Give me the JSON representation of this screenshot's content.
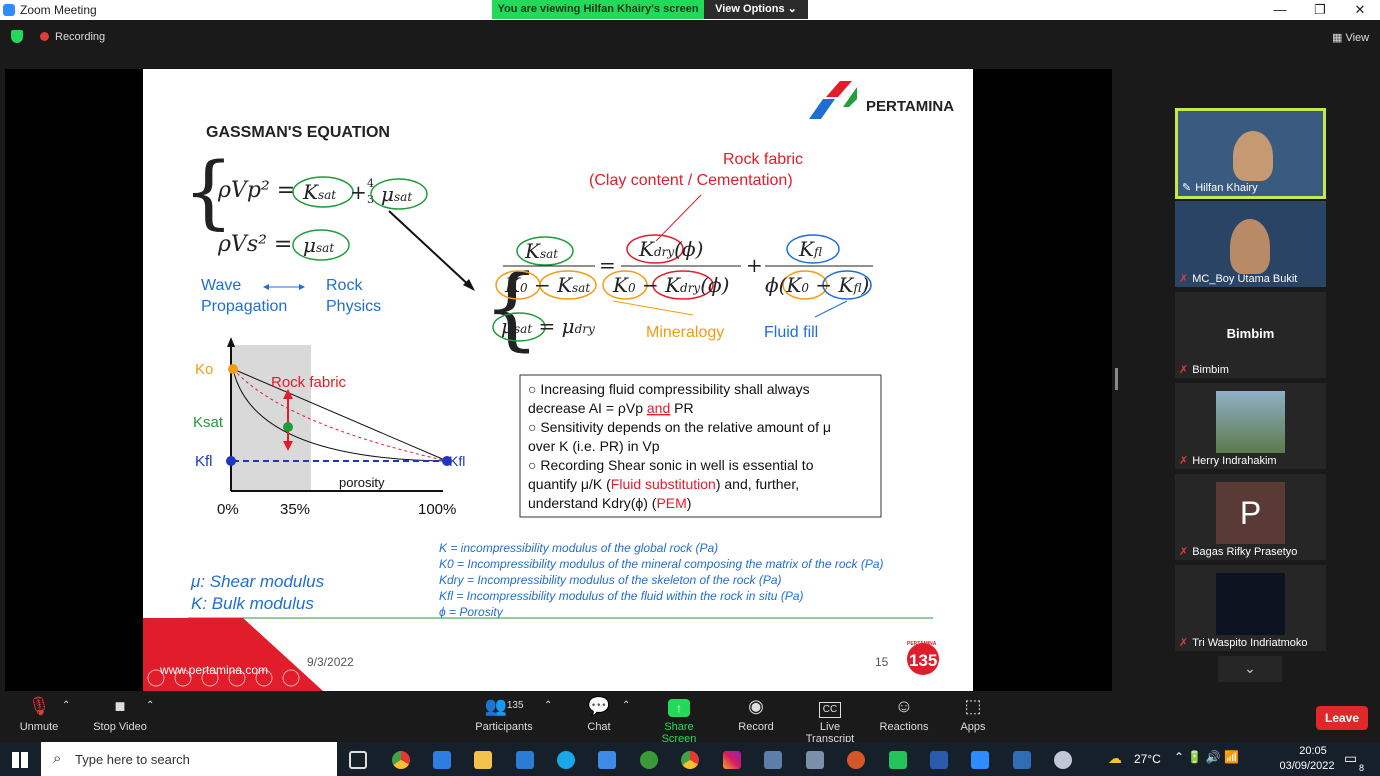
{
  "window": {
    "title": "Zoom Meeting"
  },
  "banner": {
    "viewing": "You are viewing Hilfan Khairy's screen",
    "view_options": "View Options"
  },
  "topbar": {
    "recording": "Recording",
    "view": "View"
  },
  "slide": {
    "logo": "PERTAMINA",
    "title": "GASSMAN'S EQUATION",
    "rock_fabric": "Rock fabric",
    "clay": "(Clay content / Cementation)",
    "mineralogy": "Mineralogy",
    "fluid_fill": "Fluid fill",
    "wave": "Wave",
    "propagation": "Propagation",
    "rock": "Rock",
    "physics": "Physics",
    "graph": {
      "k0": "Ko",
      "ksat": "Ksat",
      "kfl": "Kfl",
      "kfl_right": "Kfl",
      "rock_fabric": "Rock fabric",
      "porosity": "porosity",
      "t0": "0%",
      "t35": "35%",
      "t100": "100%"
    },
    "box": [
      "○ Increasing fluid compressibility shall always",
      "decrease AI = ρVp ",
      "and",
      " PR",
      "○ Sensitivity depends on the relative amount of μ",
      "over K (i.e. PR) in Vp",
      "○ Recording Shear sonic in well is essential to",
      "quantify μ/K (",
      "Fluid substitution",
      ") and, further,",
      "understand Kdry(ϕ) (",
      "PEM",
      ")"
    ],
    "defs": [
      "K = incompressibility modulus of the global rock (Pa)",
      "K0 = Incompressibility modulus of the mineral composing the matrix of the rock (Pa)",
      "Kdry = Incompressibility modulus of the skeleton of the rock (Pa)",
      "Kfl = Incompressibility modulus of the fluid within the rock in situ (Pa)",
      "ϕ = Porosity"
    ],
    "mu_shear": "μ: Shear modulus",
    "k_bulk": "K: Bulk modulus",
    "website": "www.pertamina.com",
    "date": "9/3/2022",
    "page": "15",
    "badge": "135",
    "badge_top": "PERTAMINA"
  },
  "participants": [
    {
      "name": "Hilfan Khairy",
      "type": "video",
      "active": true
    },
    {
      "name": "MC_Boy Utama Bukit",
      "type": "video"
    },
    {
      "name": "Bimbim",
      "type": "name",
      "label": "Bimbim"
    },
    {
      "name": "Herry Indrahakim",
      "type": "photo"
    },
    {
      "name": "Bagas Rifky Prasetyo",
      "type": "initial",
      "initial": "P"
    },
    {
      "name": "Tri Waspito Indriatmoko",
      "type": "photo"
    }
  ],
  "toolbar": {
    "unmute": "Unmute",
    "stop_video": "Stop Video",
    "participants": "Participants",
    "participants_count": "135",
    "chat": "Chat",
    "share": "Share Screen",
    "record": "Record",
    "transcript": "Live Transcript",
    "reactions": "Reactions",
    "apps": "Apps",
    "leave": "Leave"
  },
  "taskbar": {
    "search_placeholder": "Type here to search",
    "temp": "27°C",
    "time": "20:05",
    "date": "03/09/2022",
    "notif_count": "8"
  },
  "colors": {
    "zoom_green": "#23d959",
    "leave_red": "#e02828",
    "pertamina_red": "#e11d2b",
    "slide_blue": "#1f6ed4",
    "slide_orange": "#f39c12",
    "slide_green": "#1e9c3a"
  }
}
